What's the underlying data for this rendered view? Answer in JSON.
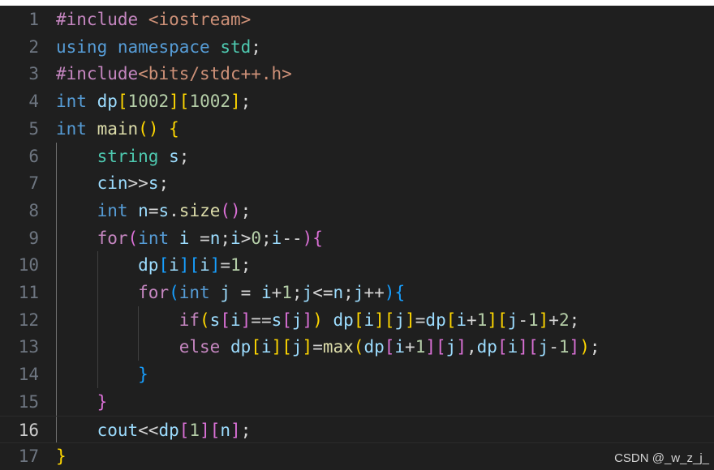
{
  "theme": {
    "background": "#1f1f1f",
    "line_number": "#6e7681",
    "line_number_active": "#cccccc",
    "colors": {
      "kw": "#569cd6",
      "ctl": "#c586c0",
      "pre": "#c586c0",
      "str": "#ce9178",
      "num": "#b5cea8",
      "fn": "#dcdcaa",
      "type": "#4ec9b0",
      "var": "#9cdcfe",
      "plain": "#d4d4d4",
      "br1": "#ffd700",
      "br2": "#da70d6",
      "br3": "#179fff"
    }
  },
  "editor": {
    "active_line": 16,
    "lines": [
      {
        "number": "1",
        "tokens": [
          [
            "pre",
            "#include"
          ],
          [
            "plain",
            " "
          ],
          [
            "str",
            "<iostream>"
          ]
        ]
      },
      {
        "number": "2",
        "tokens": [
          [
            "kw",
            "using"
          ],
          [
            "plain",
            " "
          ],
          [
            "kw",
            "namespace"
          ],
          [
            "plain",
            " "
          ],
          [
            "type",
            "std"
          ],
          [
            "plain",
            ";"
          ]
        ]
      },
      {
        "number": "3",
        "tokens": [
          [
            "pre",
            "#include"
          ],
          [
            "str",
            "<bits/stdc++.h>"
          ]
        ]
      },
      {
        "number": "4",
        "tokens": [
          [
            "kw",
            "int"
          ],
          [
            "plain",
            " "
          ],
          [
            "var",
            "dp"
          ],
          [
            "br1",
            "["
          ],
          [
            "num",
            "1002"
          ],
          [
            "br1",
            "]"
          ],
          [
            "br1",
            "["
          ],
          [
            "num",
            "1002"
          ],
          [
            "br1",
            "]"
          ],
          [
            "plain",
            ";"
          ]
        ]
      },
      {
        "number": "5",
        "tokens": [
          [
            "kw",
            "int"
          ],
          [
            "plain",
            " "
          ],
          [
            "fn",
            "main"
          ],
          [
            "br1",
            "()"
          ],
          [
            "plain",
            " "
          ],
          [
            "br1",
            "{"
          ]
        ]
      },
      {
        "number": "6",
        "tokens": [
          [
            "plain",
            "    "
          ],
          [
            "type",
            "string"
          ],
          [
            "plain",
            " "
          ],
          [
            "var",
            "s"
          ],
          [
            "plain",
            ";"
          ]
        ]
      },
      {
        "number": "7",
        "tokens": [
          [
            "plain",
            "    "
          ],
          [
            "var",
            "cin"
          ],
          [
            "plain",
            ">>"
          ],
          [
            "var",
            "s"
          ],
          [
            "plain",
            ";"
          ]
        ]
      },
      {
        "number": "8",
        "tokens": [
          [
            "plain",
            "    "
          ],
          [
            "kw",
            "int"
          ],
          [
            "plain",
            " "
          ],
          [
            "var",
            "n"
          ],
          [
            "plain",
            "="
          ],
          [
            "var",
            "s"
          ],
          [
            "plain",
            "."
          ],
          [
            "fn",
            "size"
          ],
          [
            "br2",
            "()"
          ],
          [
            "plain",
            ";"
          ]
        ]
      },
      {
        "number": "9",
        "tokens": [
          [
            "plain",
            "    "
          ],
          [
            "ctl",
            "for"
          ],
          [
            "br2",
            "("
          ],
          [
            "kw",
            "int"
          ],
          [
            "plain",
            " "
          ],
          [
            "var",
            "i"
          ],
          [
            "plain",
            " ="
          ],
          [
            "var",
            "n"
          ],
          [
            "plain",
            ";"
          ],
          [
            "var",
            "i"
          ],
          [
            "plain",
            ">"
          ],
          [
            "num",
            "0"
          ],
          [
            "plain",
            ";"
          ],
          [
            "var",
            "i"
          ],
          [
            "plain",
            "--"
          ],
          [
            "br2",
            ")"
          ],
          [
            "br2",
            "{"
          ]
        ]
      },
      {
        "number": "10",
        "tokens": [
          [
            "plain",
            "        "
          ],
          [
            "var",
            "dp"
          ],
          [
            "br3",
            "["
          ],
          [
            "var",
            "i"
          ],
          [
            "br3",
            "]"
          ],
          [
            "br3",
            "["
          ],
          [
            "var",
            "i"
          ],
          [
            "br3",
            "]"
          ],
          [
            "plain",
            "="
          ],
          [
            "num",
            "1"
          ],
          [
            "plain",
            ";"
          ]
        ]
      },
      {
        "number": "11",
        "tokens": [
          [
            "plain",
            "        "
          ],
          [
            "ctl",
            "for"
          ],
          [
            "br3",
            "("
          ],
          [
            "kw",
            "int"
          ],
          [
            "plain",
            " "
          ],
          [
            "var",
            "j"
          ],
          [
            "plain",
            " = "
          ],
          [
            "var",
            "i"
          ],
          [
            "plain",
            "+"
          ],
          [
            "num",
            "1"
          ],
          [
            "plain",
            ";"
          ],
          [
            "var",
            "j"
          ],
          [
            "plain",
            "<="
          ],
          [
            "var",
            "n"
          ],
          [
            "plain",
            ";"
          ],
          [
            "var",
            "j"
          ],
          [
            "plain",
            "++"
          ],
          [
            "br3",
            ")"
          ],
          [
            "br3",
            "{"
          ]
        ]
      },
      {
        "number": "12",
        "tokens": [
          [
            "plain",
            "            "
          ],
          [
            "ctl",
            "if"
          ],
          [
            "br1",
            "("
          ],
          [
            "var",
            "s"
          ],
          [
            "br2",
            "["
          ],
          [
            "var",
            "i"
          ],
          [
            "br2",
            "]"
          ],
          [
            "plain",
            "=="
          ],
          [
            "var",
            "s"
          ],
          [
            "br2",
            "["
          ],
          [
            "var",
            "j"
          ],
          [
            "br2",
            "]"
          ],
          [
            "br1",
            ")"
          ],
          [
            "plain",
            " "
          ],
          [
            "var",
            "dp"
          ],
          [
            "br1",
            "["
          ],
          [
            "var",
            "i"
          ],
          [
            "br1",
            "]"
          ],
          [
            "br1",
            "["
          ],
          [
            "var",
            "j"
          ],
          [
            "br1",
            "]"
          ],
          [
            "plain",
            "="
          ],
          [
            "var",
            "dp"
          ],
          [
            "br1",
            "["
          ],
          [
            "var",
            "i"
          ],
          [
            "plain",
            "+"
          ],
          [
            "num",
            "1"
          ],
          [
            "br1",
            "]"
          ],
          [
            "br1",
            "["
          ],
          [
            "var",
            "j"
          ],
          [
            "plain",
            "-"
          ],
          [
            "num",
            "1"
          ],
          [
            "br1",
            "]"
          ],
          [
            "plain",
            "+"
          ],
          [
            "num",
            "2"
          ],
          [
            "plain",
            ";"
          ]
        ]
      },
      {
        "number": "13",
        "tokens": [
          [
            "plain",
            "            "
          ],
          [
            "ctl",
            "else"
          ],
          [
            "plain",
            " "
          ],
          [
            "var",
            "dp"
          ],
          [
            "br1",
            "["
          ],
          [
            "var",
            "i"
          ],
          [
            "br1",
            "]"
          ],
          [
            "br1",
            "["
          ],
          [
            "var",
            "j"
          ],
          [
            "br1",
            "]"
          ],
          [
            "plain",
            "="
          ],
          [
            "fn",
            "max"
          ],
          [
            "br1",
            "("
          ],
          [
            "var",
            "dp"
          ],
          [
            "br2",
            "["
          ],
          [
            "var",
            "i"
          ],
          [
            "plain",
            "+"
          ],
          [
            "num",
            "1"
          ],
          [
            "br2",
            "]"
          ],
          [
            "br2",
            "["
          ],
          [
            "var",
            "j"
          ],
          [
            "br2",
            "]"
          ],
          [
            "plain",
            ","
          ],
          [
            "var",
            "dp"
          ],
          [
            "br2",
            "["
          ],
          [
            "var",
            "i"
          ],
          [
            "br2",
            "]"
          ],
          [
            "br2",
            "["
          ],
          [
            "var",
            "j"
          ],
          [
            "plain",
            "-"
          ],
          [
            "num",
            "1"
          ],
          [
            "br2",
            "]"
          ],
          [
            "br1",
            ")"
          ],
          [
            "plain",
            ";"
          ]
        ]
      },
      {
        "number": "14",
        "tokens": [
          [
            "plain",
            "        "
          ],
          [
            "br3",
            "}"
          ]
        ]
      },
      {
        "number": "15",
        "tokens": [
          [
            "plain",
            "    "
          ],
          [
            "br2",
            "}"
          ]
        ]
      },
      {
        "number": "16",
        "tokens": [
          [
            "plain",
            "    "
          ],
          [
            "var",
            "cout"
          ],
          [
            "plain",
            "<<"
          ],
          [
            "var",
            "dp"
          ],
          [
            "br2",
            "["
          ],
          [
            "num",
            "1"
          ],
          [
            "br2",
            "]"
          ],
          [
            "br2",
            "["
          ],
          [
            "var",
            "n"
          ],
          [
            "br2",
            "]"
          ],
          [
            "plain",
            ";"
          ]
        ]
      },
      {
        "number": "17",
        "tokens": [
          [
            "br1",
            "}"
          ]
        ]
      }
    ]
  },
  "watermark": "CSDN @_w_z_j_"
}
